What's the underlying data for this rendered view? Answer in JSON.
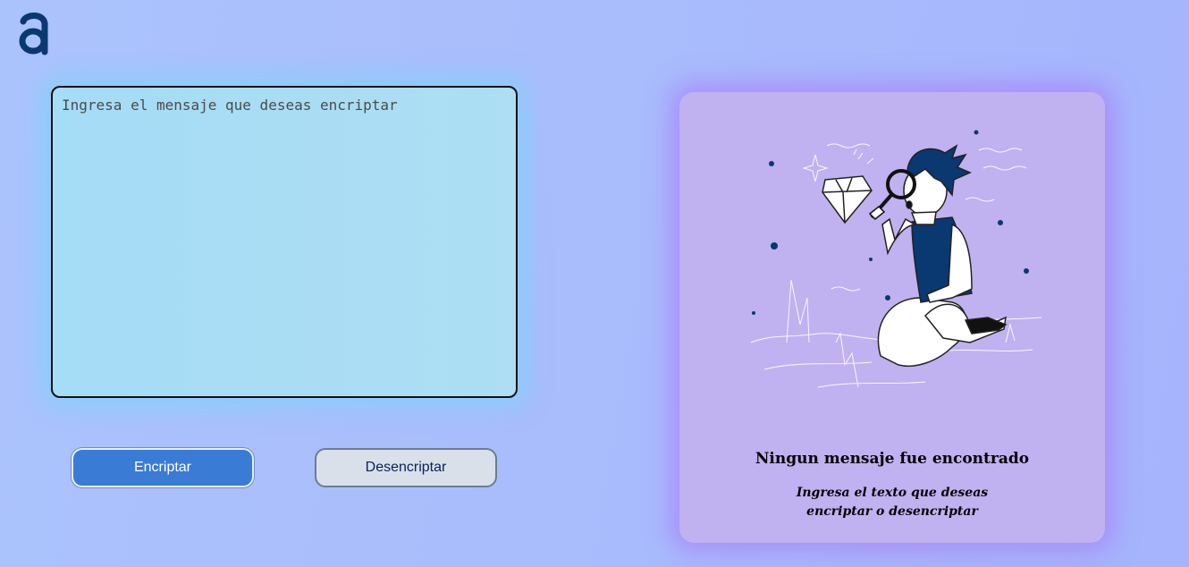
{
  "logo": {
    "icon": "alura-logo-icon",
    "color": "#0a3871"
  },
  "input": {
    "placeholder": "Ingresa el mensaje que deseas encriptar",
    "value": ""
  },
  "buttons": {
    "encrypt_label": "Encriptar",
    "decrypt_label": "Desencriptar"
  },
  "output": {
    "illustration": "person-magnifying-glass-diamond-illustration",
    "empty_title": "Ningun mensaje fue encontrado",
    "empty_subtitle": "Ingresa el texto que deseas encriptar o desencriptar"
  },
  "colors": {
    "primary": "#3a7bd5",
    "dark_blue": "#0a3871",
    "panel": "#c0b1f0",
    "input_bg": "#a5dcf6"
  }
}
